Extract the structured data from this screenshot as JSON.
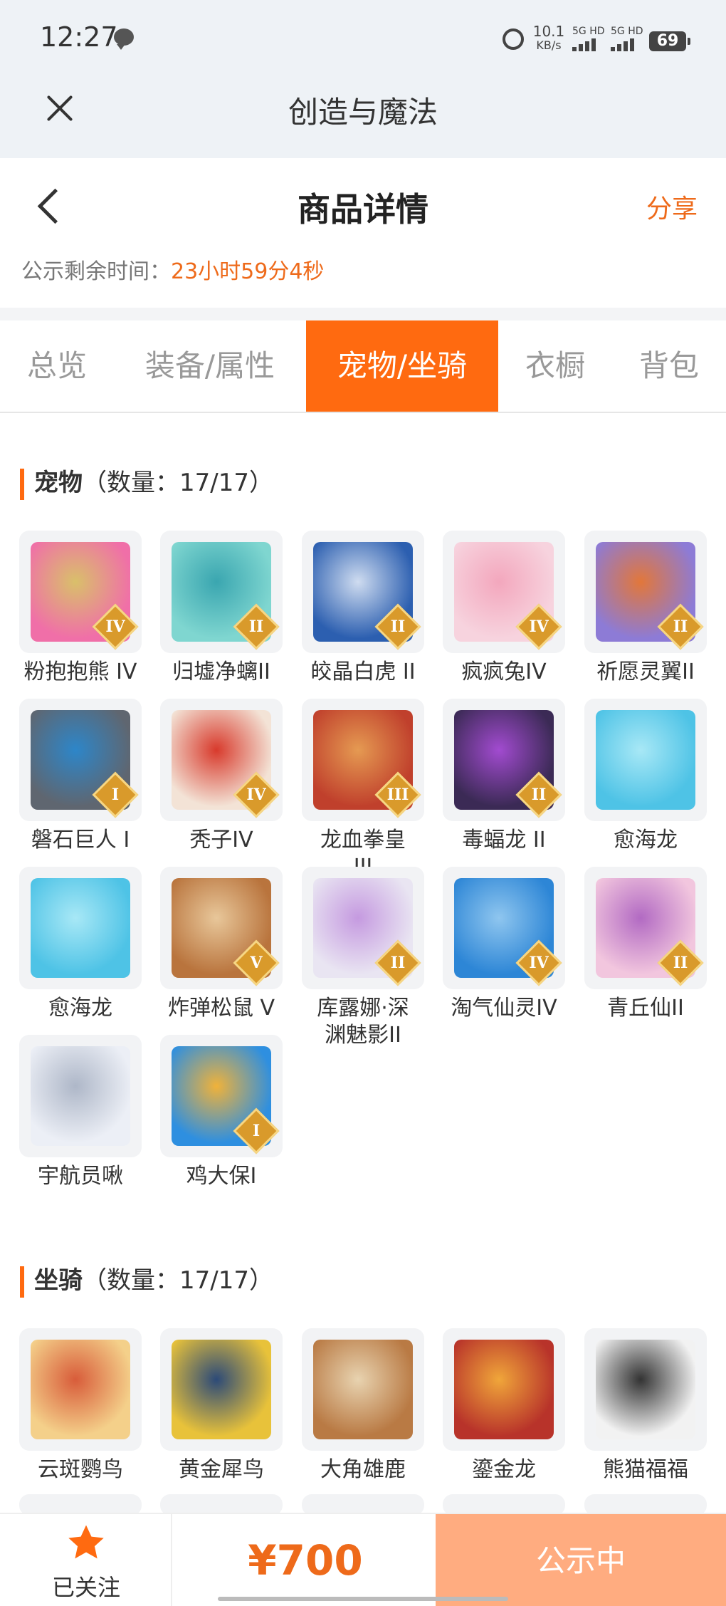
{
  "status_bar": {
    "time": "12:27",
    "net_speed": "10.1",
    "net_unit": "KB/s",
    "sim1": "5G HD",
    "sim2": "5G HD",
    "battery": "69"
  },
  "app_header": {
    "title": "创造与魔法"
  },
  "product_header": {
    "title": "商品详情",
    "share_label": "分享",
    "timer_label": "公示剩余时间：",
    "timer_value": "23小时59分4秒"
  },
  "tabs": [
    {
      "label": "总览",
      "active": false
    },
    {
      "label": "装备/属性",
      "active": false
    },
    {
      "label": "宠物/坐骑",
      "active": true
    },
    {
      "label": "衣橱",
      "active": false
    },
    {
      "label": "背包",
      "active": false
    }
  ],
  "pets": {
    "title": "宠物",
    "count_label": "（数量：17/17）",
    "items": [
      {
        "name": "粉抱抱熊 IV",
        "badge": "IV",
        "color1": "#f06fa8",
        "color2": "#d9c06a"
      },
      {
        "name": "归墟净螭II",
        "badge": "II",
        "color1": "#7fd6d0",
        "color2": "#3aa6b0"
      },
      {
        "name": "皎晶白虎 II",
        "badge": "II",
        "color1": "#2c5fb0",
        "color2": "#cfdcf0"
      },
      {
        "name": "疯疯兔IV",
        "badge": "IV",
        "color1": "#f7d3de",
        "color2": "#f3a7bd"
      },
      {
        "name": "祈愿灵翼II",
        "badge": "II",
        "color1": "#8d7bd6",
        "color2": "#e2773a"
      },
      {
        "name": "磐石巨人 I",
        "badge": "I",
        "color1": "#5f6670",
        "color2": "#2d86c9"
      },
      {
        "name": "秃子IV",
        "badge": "IV",
        "color1": "#f3e3d6",
        "color2": "#d83a2c"
      },
      {
        "name": "龙血拳皇 III",
        "badge": "III",
        "color1": "#c0402c",
        "color2": "#e59a52"
      },
      {
        "name": "毒蝠龙 II",
        "badge": "II",
        "color1": "#3b2a55",
        "color2": "#a24bd0"
      },
      {
        "name": "愈海龙",
        "badge": "",
        "color1": "#4ec3e6",
        "color2": "#a8e8f6"
      },
      {
        "name": "愈海龙",
        "badge": "",
        "color1": "#4ec3e6",
        "color2": "#a8e8f6"
      },
      {
        "name": "炸弹松鼠 V",
        "badge": "V",
        "color1": "#b9743d",
        "color2": "#e8c79a"
      },
      {
        "name": "库露娜·深渊魅影II",
        "badge": "II",
        "color1": "#e9e5f2",
        "color2": "#c59ae0"
      },
      {
        "name": "淘气仙灵IV",
        "badge": "IV",
        "color1": "#2d86d6",
        "color2": "#8fc6ef"
      },
      {
        "name": "青丘仙II",
        "badge": "II",
        "color1": "#f2c6de",
        "color2": "#b26ac3"
      },
      {
        "name": "宇航员啾",
        "badge": "",
        "color1": "#eceff6",
        "color2": "#aeb7c8"
      },
      {
        "name": "鸡大保I",
        "badge": "I",
        "color1": "#2e8fe0",
        "color2": "#f0b23a"
      }
    ]
  },
  "mounts": {
    "title": "坐骑",
    "count_label": "（数量：17/17）",
    "items": [
      {
        "name": "云斑鹦鸟",
        "badge": "",
        "color1": "#f4d08a",
        "color2": "#d85c3a"
      },
      {
        "name": "黄金犀鸟",
        "badge": "",
        "color1": "#e8c23a",
        "color2": "#2c4a78"
      },
      {
        "name": "大角雄鹿",
        "badge": "",
        "color1": "#b97a44",
        "color2": "#e8d3b0"
      },
      {
        "name": "鎏金龙",
        "badge": "",
        "color1": "#b8332a",
        "color2": "#f0a63a"
      },
      {
        "name": "熊猫福福",
        "badge": "",
        "color1": "#f2f2f2",
        "color2": "#333333"
      }
    ]
  },
  "bottom_bar": {
    "follow_label": "已关注",
    "price": "¥700",
    "status_label": "公示中"
  }
}
